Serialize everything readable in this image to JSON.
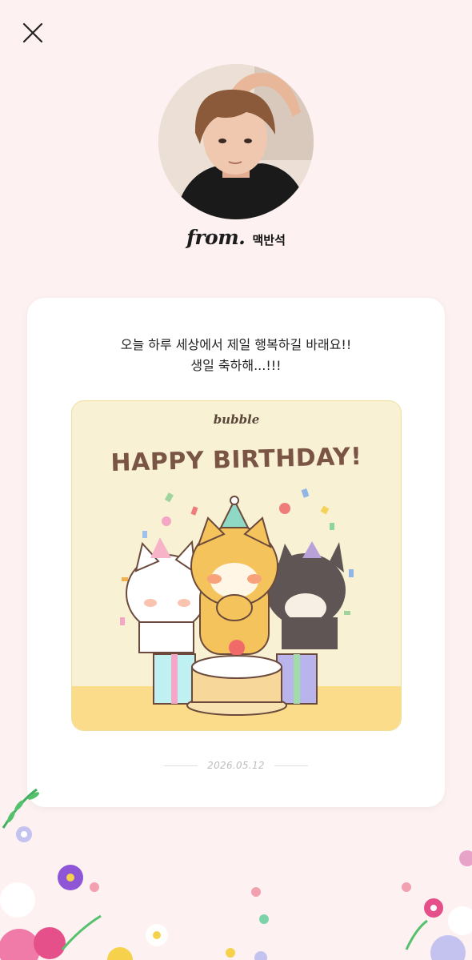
{
  "header": {
    "close_icon": "close-icon"
  },
  "sender": {
    "from_label": "from.",
    "name": "맥반석",
    "avatar_icon": "profile-photo"
  },
  "letter": {
    "line1": "오늘 하루 세상에서 제일 행복하길 바래요!!",
    "line2": "생일 축하해...!!!",
    "date": "2026.05.12"
  },
  "card_image": {
    "brand": "bubble",
    "headline": "HAPPY BIRTHDAY!"
  },
  "colors": {
    "background": "#fdf2f1",
    "card": "#ffffff",
    "card_image_bg": "#f8f1d4",
    "headline": "#7a5444"
  }
}
